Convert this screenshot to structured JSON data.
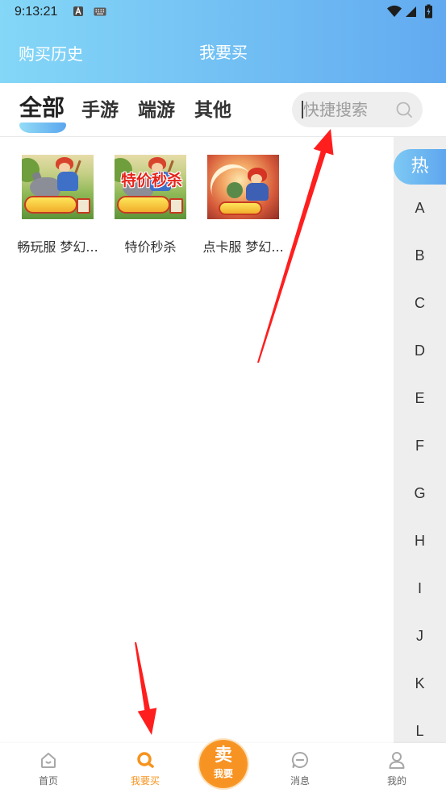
{
  "status_bar": {
    "time": "9:13:21",
    "notification_icons": [
      "a-app-icon",
      "keyboard-icon"
    ],
    "system_icons": [
      "wifi-icon",
      "signal-icon",
      "battery-charging-icon"
    ]
  },
  "header": {
    "history_link": "购买历史",
    "title": "我要买"
  },
  "tabs": [
    {
      "label": "全部",
      "active": true
    },
    {
      "label": "手游",
      "active": false
    },
    {
      "label": "端游",
      "active": false
    },
    {
      "label": "其他",
      "active": false
    }
  ],
  "search": {
    "placeholder": "快捷搜索",
    "value": "",
    "icon": "search-icon"
  },
  "games": [
    {
      "label": "畅玩服 梦幻..."
    },
    {
      "label": "特价秒杀",
      "banner": "特价秒杀"
    },
    {
      "label": "点卡服 梦幻..."
    }
  ],
  "index_bar": {
    "hot": "热",
    "letters": [
      "A",
      "B",
      "C",
      "D",
      "E",
      "F",
      "G",
      "H",
      "I",
      "J",
      "K",
      "L"
    ]
  },
  "bottom_nav": {
    "items": [
      {
        "label": "首页",
        "icon": "home-icon",
        "active": false
      },
      {
        "label": "我要买",
        "icon": "buy-search-icon",
        "active": true
      },
      {
        "label": "消息",
        "icon": "message-icon",
        "active": false
      },
      {
        "label": "我的",
        "icon": "profile-icon",
        "active": false
      }
    ],
    "sell_button": {
      "main": "卖",
      "sub": "我要"
    }
  },
  "colors": {
    "header_start": "#84d7f7",
    "header_end": "#62aaf0",
    "accent": "#f7931e",
    "tab_indicator_start": "#93dcf7",
    "tab_indicator_end": "#5aa6ee",
    "index_hot_start": "#7dc9f4",
    "index_hot_end": "#5ea6ee",
    "index_bg": "#eeeeee",
    "annotation_arrow": "#ff1e1e"
  }
}
